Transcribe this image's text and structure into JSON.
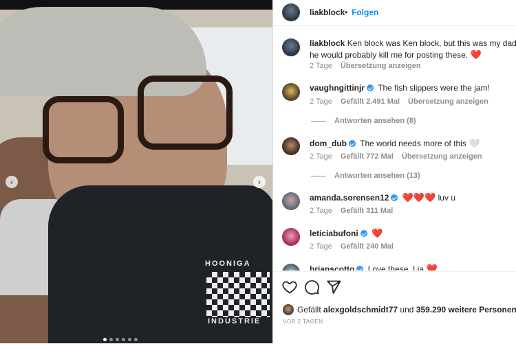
{
  "post": {
    "author": "liakblock",
    "separator": "•",
    "follow_label": "Folgen"
  },
  "comments": [
    {
      "user": "liakblock",
      "text": "Ken block was Ken block, but this was my dad. A",
      "text2": "he would probably kill me for posting these.",
      "emoji": "❤️",
      "time": "2 Tage",
      "likes": "",
      "translate": "Übersetzung anzeigen",
      "verified": false
    },
    {
      "user": "vaughngittinjr",
      "text": "The fish slippers were the jam!",
      "time": "2 Tage",
      "likes": "Gefällt 2.491 Mal",
      "translate": "Übersetzung anzeigen",
      "verified": true,
      "replies": "Antworten ansehen (8)"
    },
    {
      "user": "dom_dub",
      "text": "The world needs more of this",
      "emoji": "🤍",
      "time": "2 Tage",
      "likes": "Gefällt 772 Mal",
      "translate": "Übersetzung anzeigen",
      "verified": true,
      "replies": "Antworten ansehen (13)"
    },
    {
      "user": "amanda.sorensen12",
      "emoji": "❤️❤️❤️",
      "text": "luv u",
      "time": "2 Tage",
      "likes": "Gefällt 311 Mal",
      "verified": true
    },
    {
      "user": "leticiabufoni",
      "emoji": "❤️",
      "time": "2 Tage",
      "likes": "Gefällt 240 Mal",
      "verified": true
    },
    {
      "user": "brianscotto",
      "text": "Love these, Lia",
      "emoji": "❤️",
      "verified": true
    }
  ],
  "photo": {
    "brand_top": "HOONIGA",
    "brand_bottom": "INDUSTRIE"
  },
  "footer": {
    "likes_prefix": "Gefällt",
    "likes_user": "alexgoldschmidt77",
    "likes_connector": "und",
    "likes_count": "359.290 weitere Personen",
    "date": "VOR 2 TAGEN"
  },
  "icons": {
    "like": "heart-outline-icon",
    "comment": "comment-bubble-icon",
    "share": "paper-plane-icon",
    "prev": "chevron-left-icon",
    "next": "chevron-right-icon"
  },
  "colors": {
    "link_blue": "#0095f6",
    "verified_blue": "#3897f0",
    "muted": "#8e8e8e",
    "heart_red": "#ed4956"
  },
  "carousel": {
    "slide_count": 6,
    "active_index": 0
  }
}
